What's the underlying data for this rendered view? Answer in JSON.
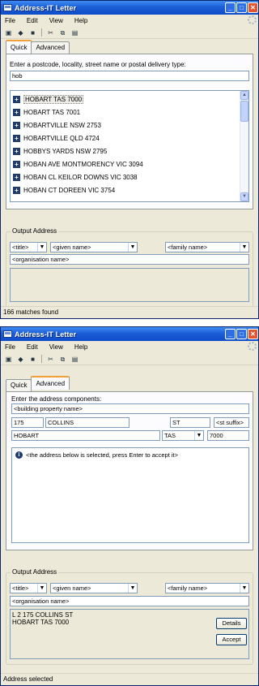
{
  "window_title": "Address-IT Letter",
  "menu": {
    "file": "File",
    "edit": "Edit",
    "view": "View",
    "help": "Help"
  },
  "tabs": {
    "quick": "Quick",
    "advanced": "Advanced"
  },
  "quick": {
    "prompt": "Enter a postcode, locality, street name or postal delivery type:",
    "search_value": "hob",
    "results": [
      "HOBART TAS 7000",
      "HOBART TAS 7001",
      "HOBARTVILLE NSW 2753",
      "HOBARTVILLE QLD 4724",
      "HOBBYS YARDS NSW 2795",
      "HOBAN AVE  MONTMORENCY VIC 3094",
      "HOBAN CL  KEILOR DOWNS VIC 3038",
      "HOBAN CT  DOREEN VIC 3754"
    ],
    "selected_index": 0,
    "status": "166 matches found"
  },
  "advanced": {
    "prompt": "Enter the address components:",
    "building_property_name": "<building property name>",
    "street_number": "175",
    "street_name": "COLLINS",
    "street_type": "ST",
    "street_suffix": "<st suffix>",
    "locality": "HOBART",
    "state": "TAS",
    "postcode": "7000",
    "info_message": "<the address below is selected, press Enter to accept it>",
    "status": "Address selected"
  },
  "output_address": {
    "group_label": "Output Address",
    "title_placeholder": "<title>",
    "given_name_placeholder": "<given name>",
    "family_name_placeholder": "<family name>",
    "organisation_placeholder": "<organisation name>",
    "result_line1": "L 2 175 COLLINS ST",
    "result_line2": "HOBART TAS 7000",
    "details_label": "Details",
    "accept_label": "Accept"
  }
}
